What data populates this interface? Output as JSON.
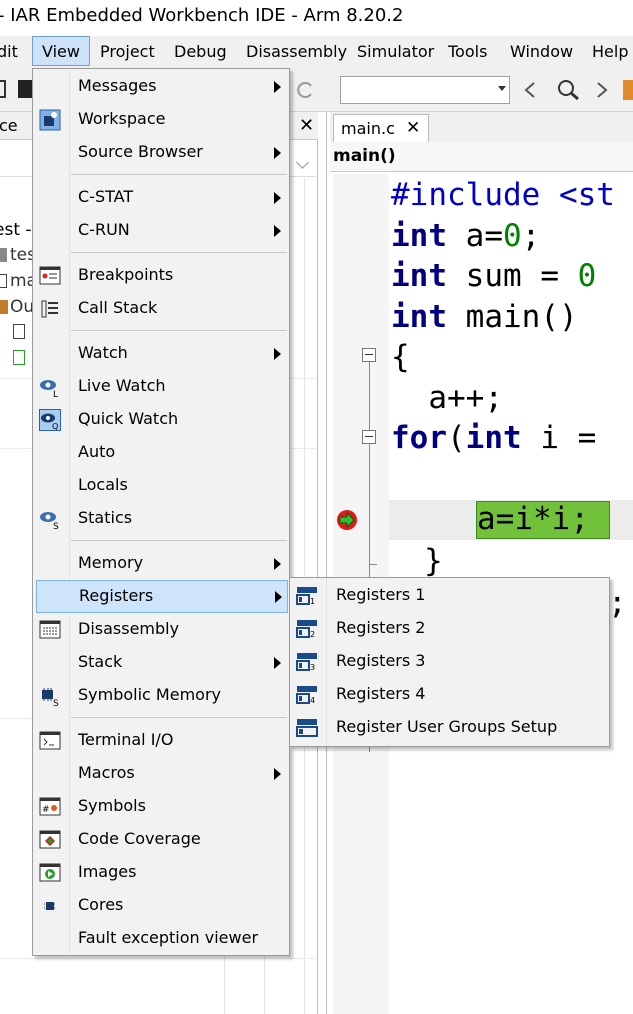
{
  "window": {
    "title": "- IAR Embedded Workbench IDE - Arm 8.20.2"
  },
  "menubar": {
    "items": [
      "Edit",
      "View",
      "Project",
      "Debug",
      "Disassembly",
      "Simulator",
      "Tools",
      "Window",
      "Help"
    ],
    "edit_visible": "dit",
    "active": "View"
  },
  "workspace": {
    "tab_label": "ce",
    "close_label": "✕",
    "tree_fragments": [
      "est -",
      "tes",
      "ma",
      "Ou"
    ]
  },
  "editor": {
    "tab_label": "main.c",
    "tab_close": "✕",
    "function_bar": "main()",
    "code_lines": [
      "#include <st",
      "int a=0;",
      "int sum = 0",
      "int main()",
      "{",
      "  a++;",
      "for(int i =",
      "a=i*i;",
      "}",
      ";"
    ],
    "breakpoint_line": "a=i*i;",
    "colors": {
      "keyword_blue": "#0000c8",
      "number": "#008000",
      "current_line_bg": "#72c13b"
    }
  },
  "view_menu": {
    "items": [
      {
        "label": "Messages",
        "submenu": true,
        "icon": ""
      },
      {
        "label": "Workspace",
        "submenu": false,
        "icon": "workspace-icon"
      },
      {
        "label": "Source Browser",
        "submenu": true,
        "icon": ""
      },
      {
        "label": "C-STAT",
        "submenu": true,
        "icon": ""
      },
      {
        "label": "C-RUN",
        "submenu": true,
        "icon": ""
      },
      {
        "label": "Breakpoints",
        "submenu": false,
        "icon": "breakpoints-icon"
      },
      {
        "label": "Call Stack",
        "submenu": false,
        "icon": "call-stack-icon"
      },
      {
        "label": "Watch",
        "submenu": true,
        "icon": ""
      },
      {
        "label": "Live Watch",
        "submenu": false,
        "icon": "live-watch-icon"
      },
      {
        "label": "Quick Watch",
        "submenu": false,
        "icon": "quick-watch-icon"
      },
      {
        "label": "Auto",
        "submenu": false,
        "icon": ""
      },
      {
        "label": "Locals",
        "submenu": false,
        "icon": ""
      },
      {
        "label": "Statics",
        "submenu": false,
        "icon": "statics-icon"
      },
      {
        "label": "Memory",
        "submenu": true,
        "icon": ""
      },
      {
        "label": "Registers",
        "submenu": true,
        "icon": "",
        "highlighted": true
      },
      {
        "label": "Disassembly",
        "submenu": false,
        "icon": "disassembly-icon"
      },
      {
        "label": "Stack",
        "submenu": true,
        "icon": ""
      },
      {
        "label": "Symbolic Memory",
        "submenu": false,
        "icon": "symbolic-memory-icon"
      },
      {
        "label": "Terminal I/O",
        "submenu": false,
        "icon": "terminal-icon"
      },
      {
        "label": "Macros",
        "submenu": true,
        "icon": ""
      },
      {
        "label": "Symbols",
        "submenu": false,
        "icon": "symbols-icon"
      },
      {
        "label": "Code Coverage",
        "submenu": false,
        "icon": "code-coverage-icon"
      },
      {
        "label": "Images",
        "submenu": false,
        "icon": "images-icon"
      },
      {
        "label": "Cores",
        "submenu": false,
        "icon": "cores-icon"
      },
      {
        "label": "Fault exception viewer",
        "submenu": false,
        "icon": ""
      }
    ]
  },
  "registers_submenu": {
    "items": [
      "Registers 1",
      "Registers 2",
      "Registers 3",
      "Registers 4",
      "Register User Groups Setup"
    ]
  }
}
